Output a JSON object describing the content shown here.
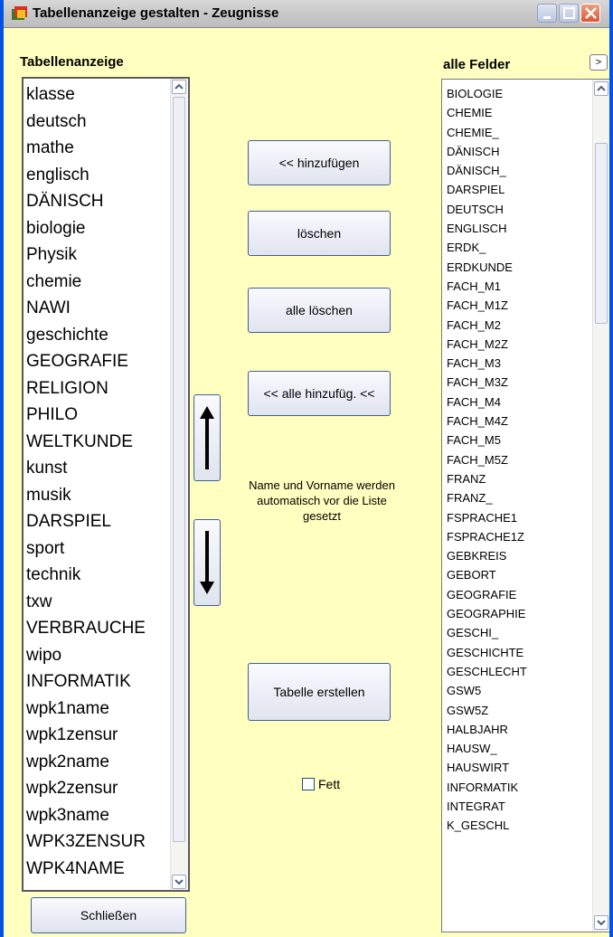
{
  "window": {
    "title": "Tabellenanzeige gestalten - Zeugnisse"
  },
  "left_panel": {
    "label": "Tabellenanzeige",
    "items": [
      "klasse",
      "deutsch",
      "mathe",
      "englisch",
      "DÄNISCH",
      "biologie",
      "Physik",
      "chemie",
      "NAWI",
      "geschichte",
      "GEOGRAFIE",
      "RELIGION",
      "PHILO",
      "WELTKUNDE",
      "kunst",
      "musik",
      "DARSPIEL",
      "sport",
      "technik",
      "txw",
      "VERBRAUCHE",
      "wipo",
      "INFORMATIK",
      "wpk1name",
      "wpk1zensur",
      "wpk2name",
      "wpk2zensur",
      "wpk3name",
      "WPK3ZENSUR",
      "WPK4NAME"
    ]
  },
  "right_panel": {
    "label": "alle Felder",
    "expand_label": ">",
    "items": [
      "BIOLOGIE",
      "CHEMIE",
      "CHEMIE_",
      "DÄNISCH",
      "DÄNISCH_",
      "DARSPIEL",
      "DEUTSCH",
      "ENGLISCH",
      "ERDK_",
      "ERDKUNDE",
      "FACH_M1",
      "FACH_M1Z",
      "FACH_M2",
      "FACH_M2Z",
      "FACH_M3",
      "FACH_M3Z",
      "FACH_M4",
      "FACH_M4Z",
      "FACH_M5",
      "FACH_M5Z",
      "FRANZ",
      "FRANZ_",
      "FSPRACHE1",
      "FSPRACHE1Z",
      "GEBKREIS",
      "GEBORT",
      "GEOGRAFIE",
      "GEOGRAPHIE",
      "GESCHI_",
      "GESCHICHTE",
      "GESCHLECHT",
      "GSW5",
      "GSW5Z",
      "HALBJAHR",
      "HAUSW_",
      "HAUSWIRT",
      "INFORMATIK",
      "INTEGRAT",
      "K_GESCHL"
    ]
  },
  "buttons": {
    "add": "<< hinzufügen",
    "delete": "löschen",
    "delete_all": "alle löschen",
    "add_all": "<< alle hinzufüg. <<",
    "create_table": "Tabelle erstellen",
    "close": "Schließen"
  },
  "note": "Name und Vorname werden automatisch vor die Liste gesetzt",
  "bold_checkbox": {
    "label": "Fett",
    "checked": false
  }
}
